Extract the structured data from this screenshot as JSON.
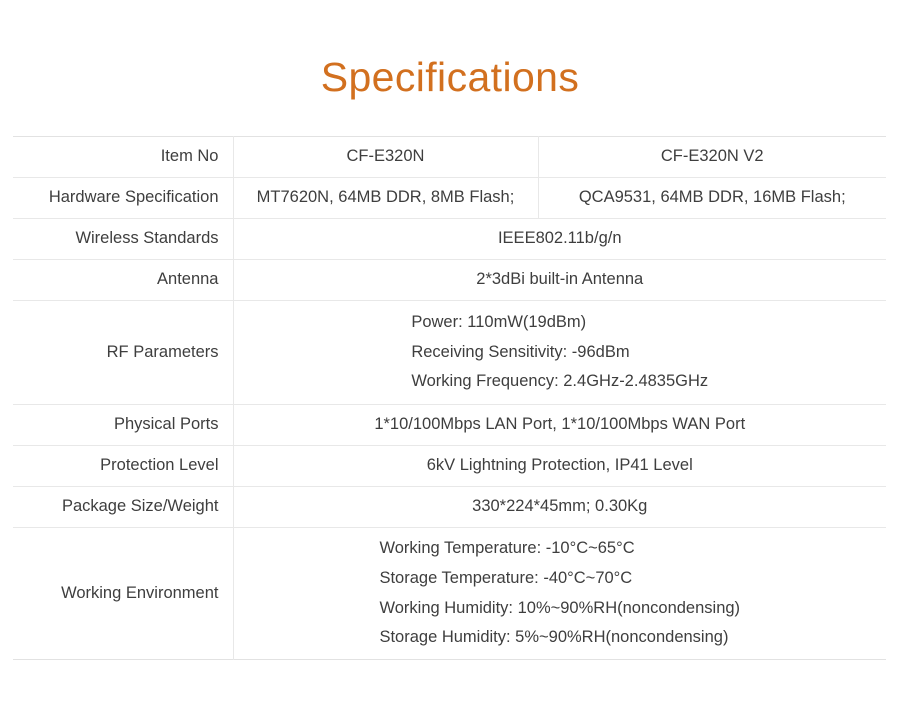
{
  "header": {
    "title": "Specifications"
  },
  "theme": {
    "title_color": "#d2701f",
    "text_color": "#3e3e3e",
    "border_color": "#e8e8e8",
    "background": "#ffffff"
  },
  "table": {
    "columns": [
      "Item No",
      "CF-E320N",
      "CF-E320N V2"
    ],
    "rows": [
      {
        "label": "Item No",
        "type": "split",
        "v1": "CF-E320N",
        "v2": "CF-E320N V2"
      },
      {
        "label": "Hardware Specification",
        "type": "split",
        "v1": "MT7620N, 64MB DDR, 8MB Flash;",
        "v2": "QCA9531, 64MB DDR, 16MB Flash;"
      },
      {
        "label": "Wireless Standards",
        "type": "merged",
        "value": "IEEE802.11b/g/n"
      },
      {
        "label": "Antenna",
        "type": "merged",
        "value": "2*3dBi built-in Antenna"
      },
      {
        "label": "RF Parameters",
        "type": "merged-multiline",
        "lines": [
          "Power: 110mW(19dBm)",
          "Receiving Sensitivity: -96dBm",
          "Working Frequency: 2.4GHz-2.4835GHz"
        ]
      },
      {
        "label": "Physical Ports",
        "type": "merged",
        "value": "1*10/100Mbps LAN Port, 1*10/100Mbps WAN Port"
      },
      {
        "label": "Protection Level",
        "type": "merged",
        "value": "6kV Lightning Protection, IP41 Level"
      },
      {
        "label": "Package Size/Weight",
        "type": "merged",
        "value": "330*224*45mm; 0.30Kg"
      },
      {
        "label": "Working Environment",
        "type": "merged-multiline",
        "lines": [
          "Working Temperature: -10°C~65°C",
          "Storage Temperature: -40°C~70°C",
          "Working Humidity: 10%~90%RH(noncondensing)",
          "Storage Humidity: 5%~90%RH(noncondensing)"
        ]
      }
    ]
  }
}
